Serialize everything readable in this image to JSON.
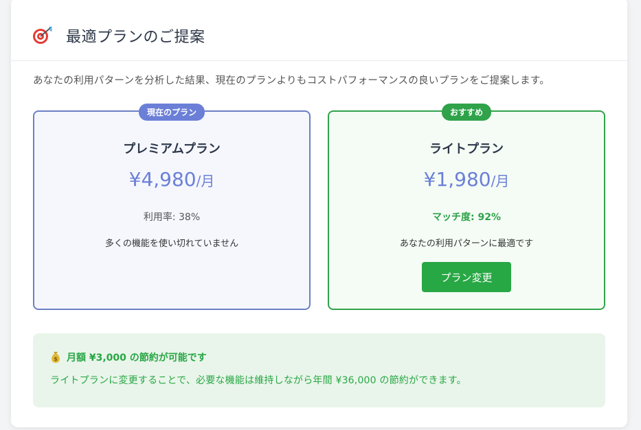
{
  "header": {
    "icon": "dart-target-icon",
    "title": "最適プランのご提案"
  },
  "intro": "あなたの利用パターンを分析した結果、現在のプランよりもコストパフォーマンスの良いプランをご提案します。",
  "plans": [
    {
      "badge": "現在のプラン",
      "name": "プレミアムプラン",
      "price": "¥4,980",
      "unit": "/月",
      "metric": "利用率: 38%",
      "note": "多くの機能を使い切れていません",
      "accent": "#6b7fd7"
    },
    {
      "badge": "おすすめ",
      "name": "ライトプラン",
      "price": "¥1,980",
      "unit": "/月",
      "metric": "マッチ度: 92%",
      "note": "あなたの利用パターンに最適です",
      "button": "プラン変更",
      "accent": "#2fa24a"
    }
  ],
  "savings": {
    "icon": "money-bag-icon",
    "title": "月額 ¥3,000 の節約が可能です",
    "text": "ライトプランに変更することで、必要な機能は維持しながら年間 ¥36,000 の節約ができます。"
  }
}
